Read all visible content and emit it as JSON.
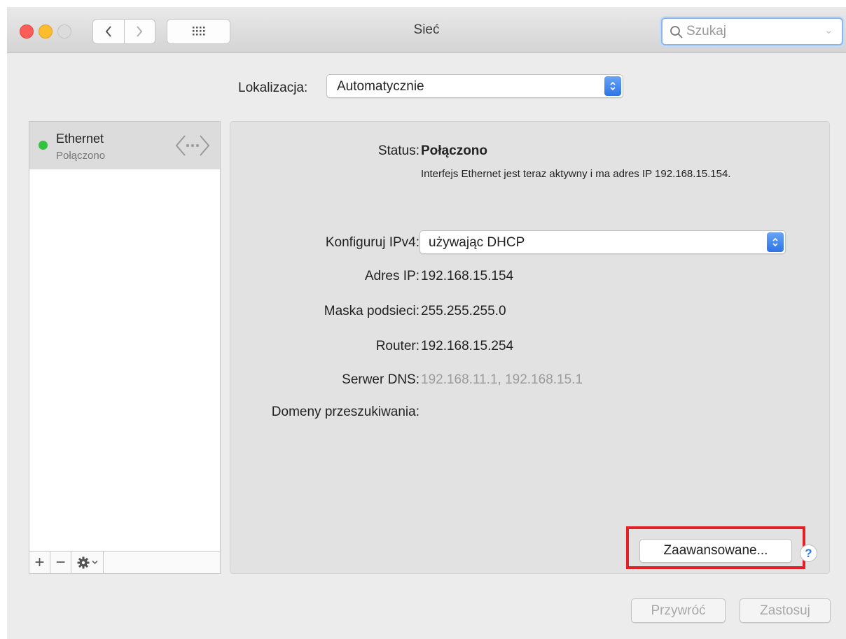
{
  "window": {
    "title": "Sieć"
  },
  "search": {
    "placeholder": "Szukaj",
    "value": ""
  },
  "location": {
    "label": "Lokalizacja:",
    "value": "Automatycznie"
  },
  "services": [
    {
      "name": "Ethernet",
      "status": "Połączono",
      "status_color": "#32c33f"
    }
  ],
  "detail": {
    "status_label": "Status:",
    "status_value": "Połączono",
    "status_description": "Interfejs Ethernet jest teraz aktywny i ma adres IP 192.168.15.154.",
    "configure_label": "Konfiguruj IPv4:",
    "configure_value": "używając DHCP",
    "ip_label": "Adres IP:",
    "ip_value": "192.168.15.154",
    "mask_label": "Maska podsieci:",
    "mask_value": "255.255.255.0",
    "router_label": "Router:",
    "router_value": "192.168.15.254",
    "dns_label": "Serwer DNS:",
    "dns_value": "192.168.11.1, 192.168.15.1",
    "search_domains_label": "Domeny przeszukiwania:"
  },
  "buttons": {
    "advanced": "Zaawansowane...",
    "help": "?",
    "revert": "Przywróć",
    "apply": "Zastosuj"
  },
  "sidebar_tools": {
    "add": "+",
    "remove": "−"
  },
  "colors": {
    "accent": "#2d74e6",
    "highlight": "#e42027"
  }
}
